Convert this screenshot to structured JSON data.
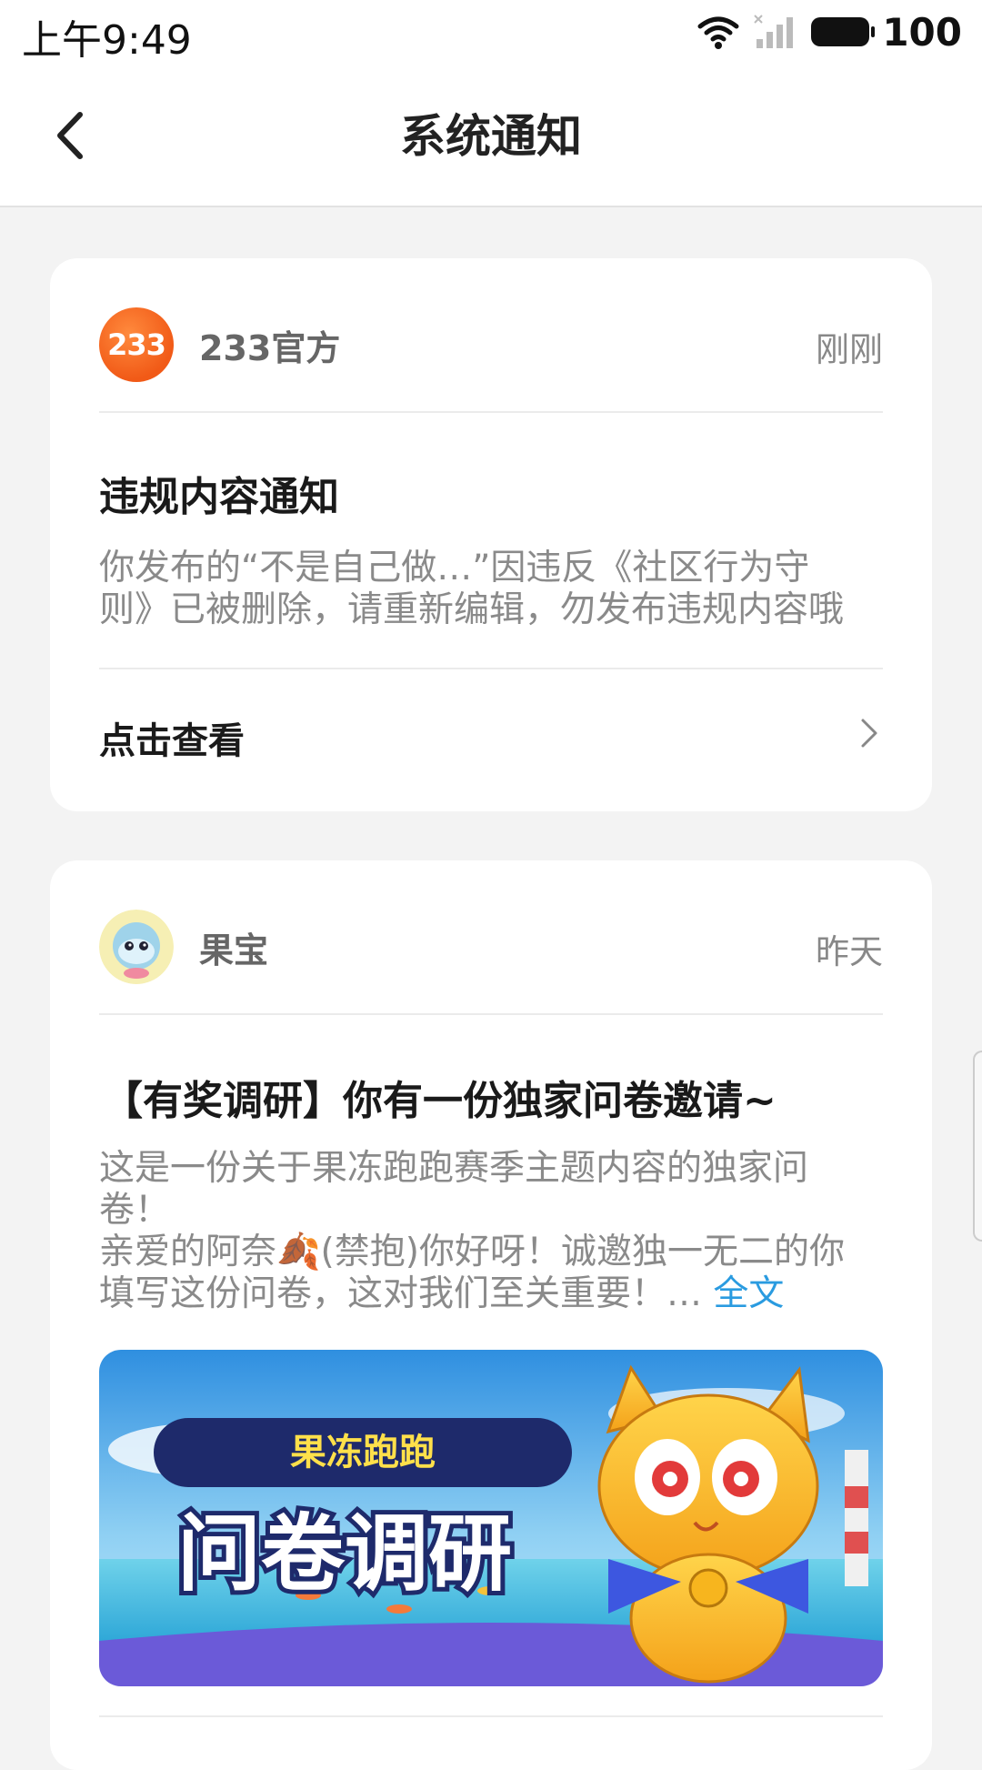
{
  "status_bar": {
    "time": "上午9:49",
    "battery": "100"
  },
  "nav": {
    "title": "系统通知"
  },
  "notifications": [
    {
      "sender": "233官方",
      "avatar_text": "233",
      "time": "刚刚",
      "title": "违规内容通知",
      "body_line1": "你发布的“不是自己做…”因违反《社区行为守",
      "body_line2": "则》已被删除，请重新编辑，勿发布违规内容哦",
      "action_label": "点击查看"
    },
    {
      "sender": "果宝",
      "time": "昨天",
      "title": "【有奖调研】你有一份独家问卷邀请~",
      "body_line1": "这是一份关于果冻跑跑赛季主题内容的独家问",
      "body_line2": "卷！",
      "body_line3": "亲爱的阿奈🍂(禁抱)你好呀！诚邀独一无二的你",
      "body_line4": "填写这份问卷，这对我们至关重要！…",
      "full_text_link": "全文",
      "banner": {
        "subtitle": "果冻跑跑",
        "title": "问卷调研"
      }
    }
  ],
  "colors": {
    "brand_orange": "#f15a17",
    "link_blue": "#2a9be0",
    "background": "#f3f3f3"
  }
}
